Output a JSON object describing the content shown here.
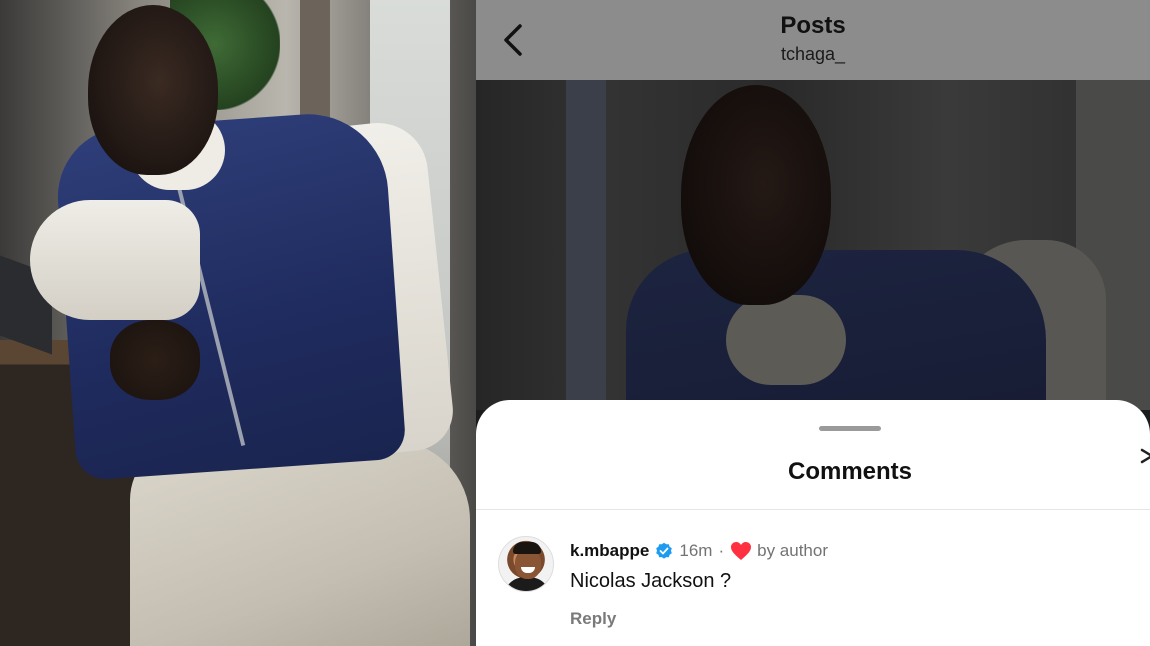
{
  "post_header": {
    "title": "Posts",
    "username": "tchaga_"
  },
  "comments_sheet": {
    "title": "Comments"
  },
  "comment": {
    "username": "k.mbappe",
    "time": "16m",
    "separator": "·",
    "liked_by": "by author",
    "text": "Nicolas Jackson ?",
    "reply_label": "Reply"
  },
  "icons": {
    "back": "chevron-left-icon",
    "verified": "verified-badge-icon",
    "liked": "heart-icon",
    "send": "send-icon"
  },
  "colors": {
    "verified_blue": "#1d9bf0",
    "heart_red": "#ff3040",
    "sheet_bg": "#ffffff",
    "header_bg": "#8c8c8c"
  }
}
